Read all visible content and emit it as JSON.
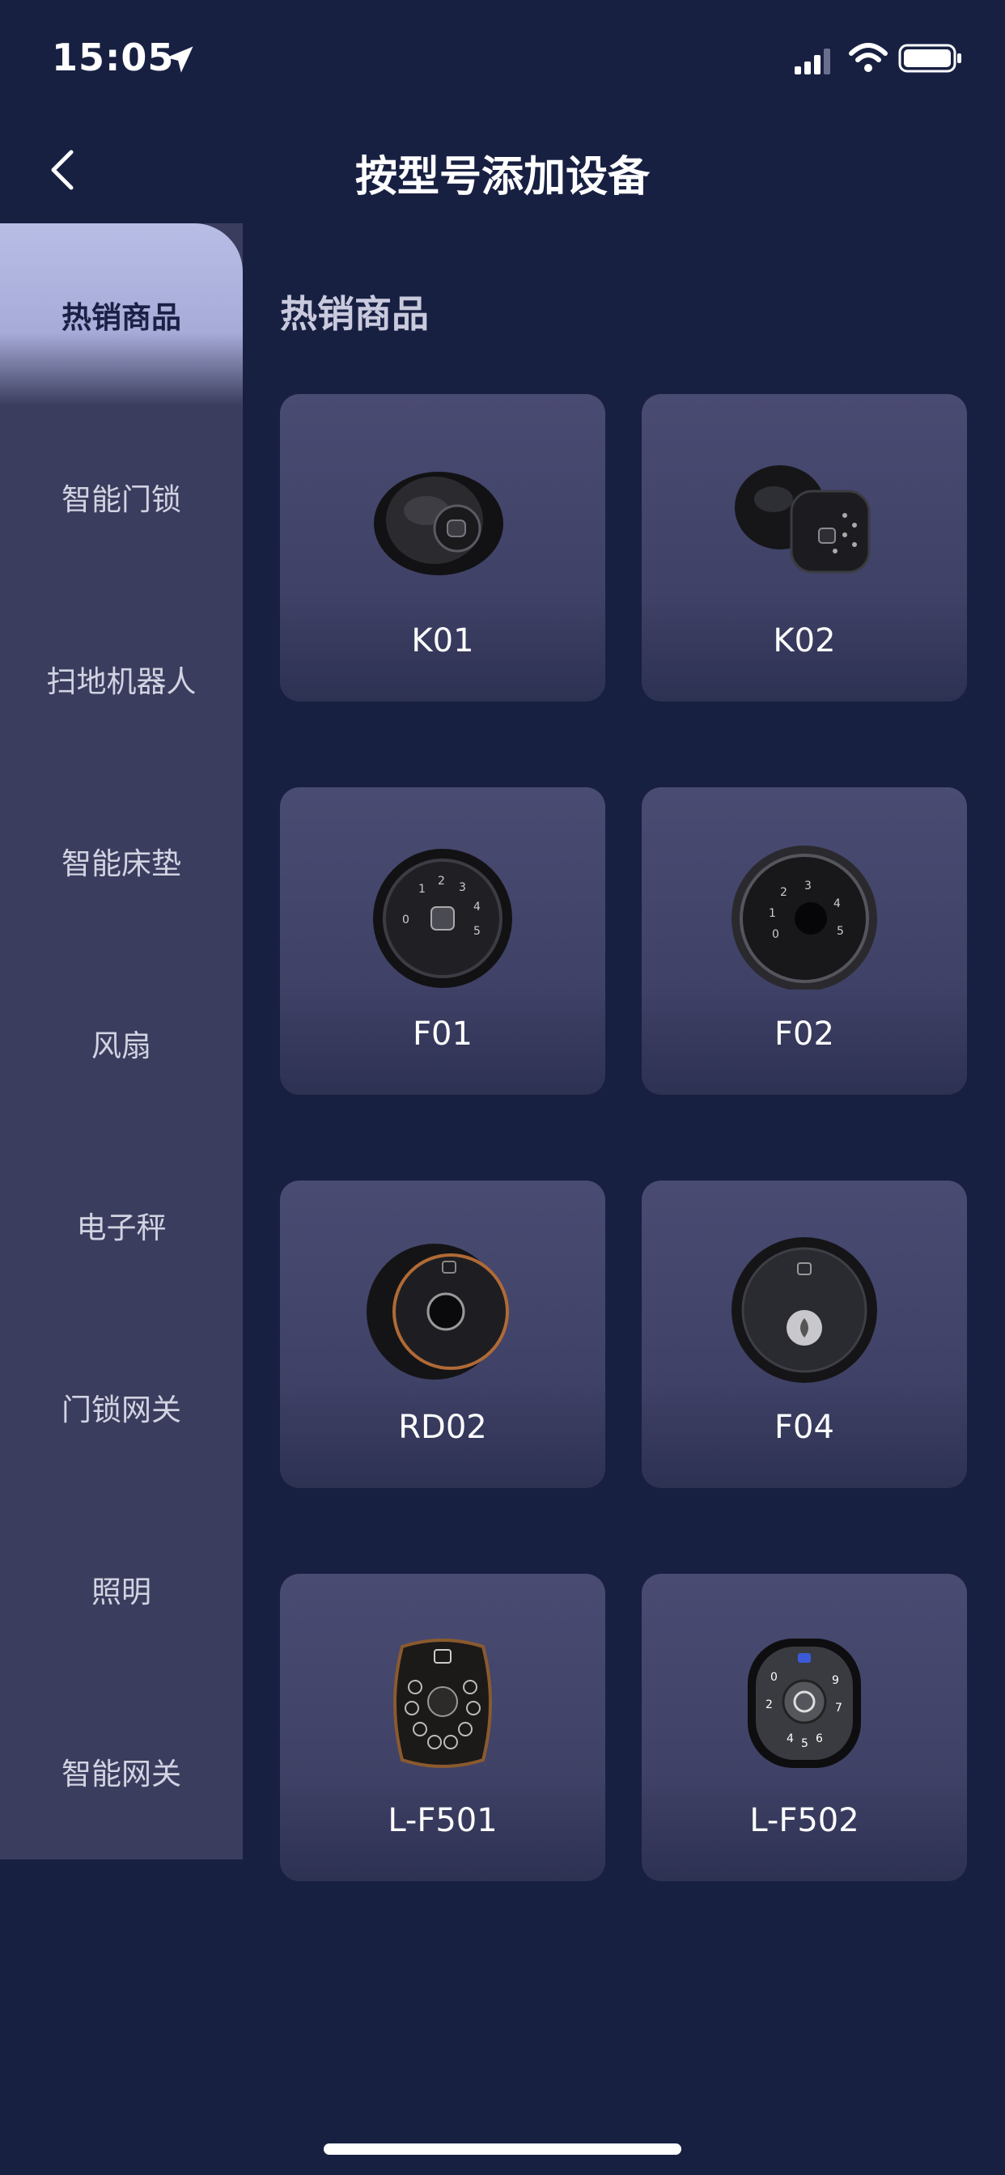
{
  "status_bar": {
    "time": "15:05"
  },
  "header": {
    "title": "按型号添加设备"
  },
  "sidebar": {
    "items": [
      {
        "label": "热销商品",
        "active": true
      },
      {
        "label": "智能门锁"
      },
      {
        "label": "扫地机器人"
      },
      {
        "label": "智能床垫"
      },
      {
        "label": "风扇"
      },
      {
        "label": "电子秤"
      },
      {
        "label": "门锁网关"
      },
      {
        "label": "照明"
      },
      {
        "label": "智能网关"
      }
    ]
  },
  "section": {
    "title": "热销商品"
  },
  "products": [
    {
      "label": "K01",
      "icon": "knob-lock-icon"
    },
    {
      "label": "K02",
      "icon": "knob-keypad-lock-icon"
    },
    {
      "label": "F01",
      "icon": "round-keypad-lock-icon"
    },
    {
      "label": "F02",
      "icon": "round-fingerprint-lock-icon"
    },
    {
      "label": "RD02",
      "icon": "fingerprint-deadbolt-icon"
    },
    {
      "label": "F04",
      "icon": "smart-touch-lock-icon"
    },
    {
      "label": "L-F501",
      "icon": "ornate-keypad-lock-icon"
    },
    {
      "label": "L-F502",
      "icon": "keypad-lever-lock-icon"
    }
  ]
}
